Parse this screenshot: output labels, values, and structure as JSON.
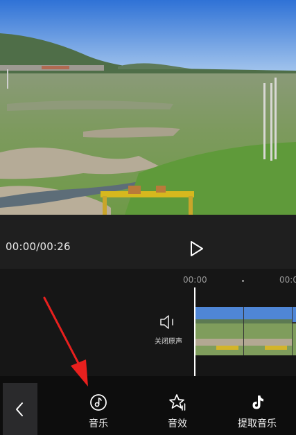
{
  "player": {
    "timecode": "00:00/00:26",
    "play_icon": "play-icon"
  },
  "timeline": {
    "ruler_labels": [
      "00:00",
      "00:0"
    ],
    "mute_label": "关闭原声",
    "mute_icon": "speaker-mute-icon",
    "clip_count_visible": 2
  },
  "toolbar": {
    "back_icon": "chevron-left-icon",
    "items": [
      {
        "label": "音乐",
        "icon": "music-note-icon"
      },
      {
        "label": "音效",
        "icon": "star-sparkle-icon"
      },
      {
        "label": "提取音乐",
        "icon": "tiktok-note-icon"
      }
    ]
  },
  "annotation": {
    "arrow_color": "#e8201e"
  }
}
